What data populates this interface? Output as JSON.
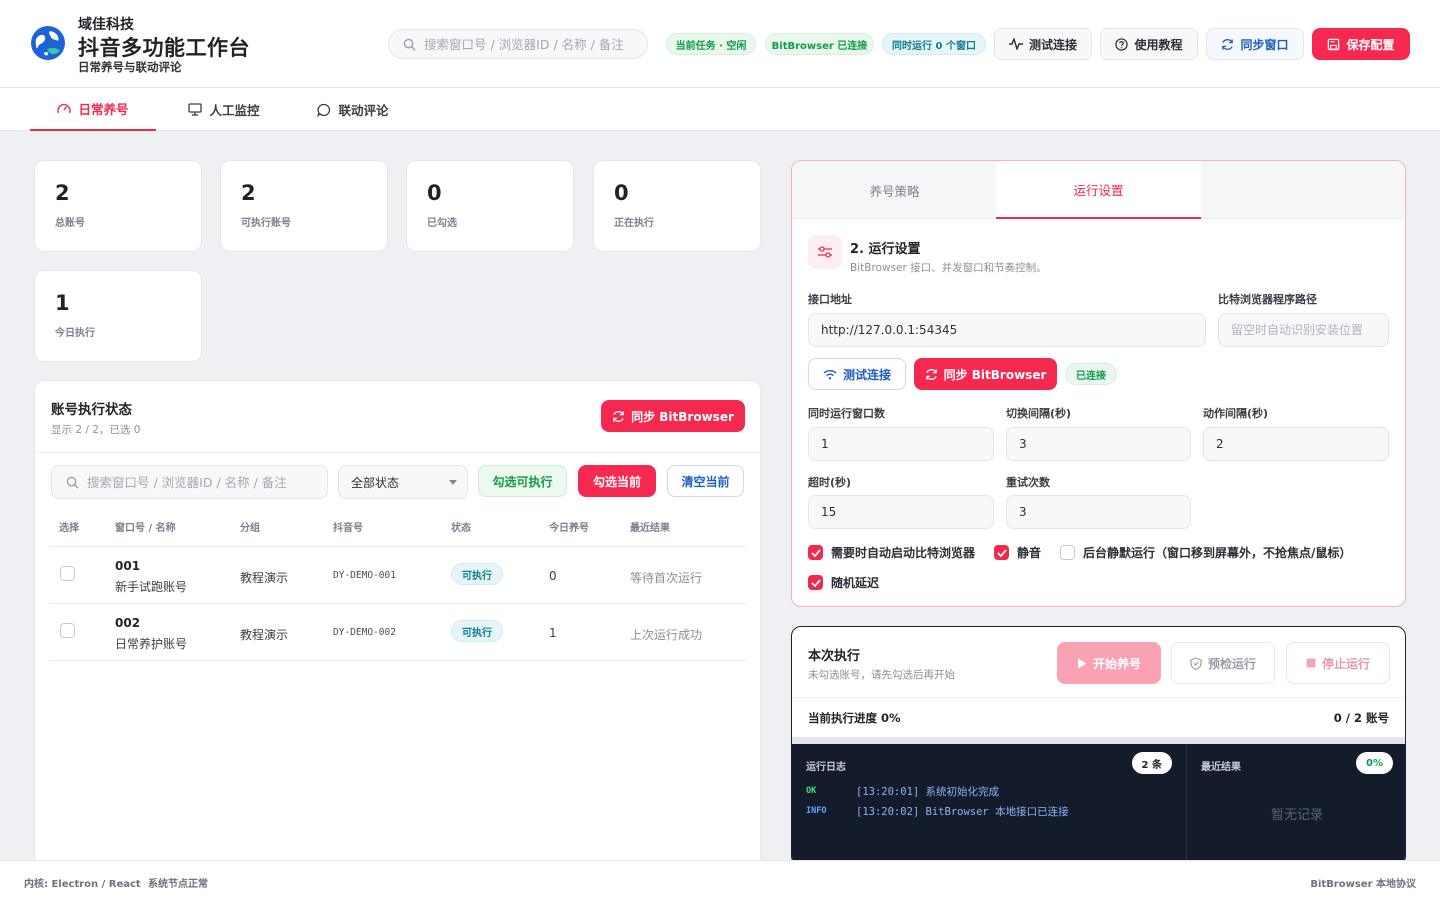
{
  "app": {
    "company": "域佳科技",
    "title": "抖音多功能工作台",
    "subtitle": "日常养号与联动评论"
  },
  "header": {
    "search_placeholder": "搜索窗口号 / 浏览器ID / 名称 / 备注",
    "pills": [
      "当前任务 · 空闲",
      "BitBrowser 已连接",
      "同时运行 0 个窗口"
    ],
    "buttons": {
      "test": "测试连接",
      "tutorial": "使用教程",
      "sync": "同步窗口",
      "save": "保存配置"
    }
  },
  "tabs": [
    "日常养号",
    "人工监控",
    "联动评论"
  ],
  "active_tab": "日常养号",
  "stats": [
    {
      "value": "2",
      "label": "总账号"
    },
    {
      "value": "2",
      "label": "可执行账号"
    },
    {
      "value": "0",
      "label": "已勾选"
    },
    {
      "value": "0",
      "label": "正在执行"
    },
    {
      "value": "1",
      "label": "今日执行"
    }
  ],
  "accounts": {
    "title": "账号执行状态",
    "subtitle": "显示 2 / 2，已选 0",
    "sync_button": "同步 BitBrowser",
    "search_placeholder": "搜索窗口号 / 浏览器ID / 名称 / 备注",
    "filter_value": "全部状态",
    "select_executable": "勾选可执行",
    "select_current": "勾选当前",
    "clear_current": "清空当前",
    "columns": [
      "选择",
      "窗口号 / 名称",
      "分组",
      "抖音号",
      "状态",
      "今日养号",
      "最近结果"
    ],
    "rows": [
      {
        "no": "001",
        "name": "新手试跑账号",
        "group": "教程演示",
        "douyin": "DY-DEMO-001",
        "status": "可执行",
        "today": "0",
        "result": "等待首次运行"
      },
      {
        "no": "002",
        "name": "日常养护账号",
        "group": "教程演示",
        "douyin": "DY-DEMO-002",
        "status": "可执行",
        "today": "1",
        "result": "上次运行成功"
      }
    ]
  },
  "settings": {
    "tabs": [
      "养号策略",
      "运行设置"
    ],
    "active_tab": "运行设置",
    "title": "2. 运行设置",
    "desc": "BitBrowser 接口、并发窗口和节奏控制。",
    "api_label": "接口地址",
    "api_value": "http://127.0.0.1:54345",
    "path_label": "比特浏览器程序路径",
    "path_placeholder": "留空时自动识别安装位置",
    "test_button": "测试连接",
    "sync_button": "同步 BitBrowser",
    "connected": "已连接",
    "concurrent_label": "同时运行窗口数",
    "concurrent_value": "1",
    "switch_label": "切换间隔(秒)",
    "switch_value": "3",
    "action_label": "动作间隔(秒)",
    "action_value": "2",
    "timeout_label": "超时(秒)",
    "timeout_value": "15",
    "retry_label": "重试次数",
    "retry_value": "3",
    "checks": [
      {
        "label": "需要时自动启动比特浏览器",
        "checked": true
      },
      {
        "label": "静音",
        "checked": true
      },
      {
        "label": "后台静默运行（窗口移到屏幕外，不抢焦点/鼠标）",
        "checked": false
      },
      {
        "label": "随机延迟",
        "checked": true
      }
    ]
  },
  "execution": {
    "title": "本次执行",
    "subtitle": "未勾选账号，请先勾选后再开始",
    "start": "开始养号",
    "precheck": "预检运行",
    "stop": "停止运行",
    "progress_label": "当前执行进度 0%",
    "progress_count": "0 / 2 账号",
    "progress": 0,
    "log_title": "运行日志",
    "log_count": "2 条",
    "logs": [
      {
        "level": "OK",
        "text": "[13:20:01] 系统初始化完成",
        "color": "#4ade80"
      },
      {
        "level": "INFO",
        "text": "[13:20:02] BitBrowser 本地接口已连接",
        "color": "#60a5fa"
      }
    ],
    "result_title": "最近结果",
    "result_pct": "0%",
    "result_empty": "暂无记录"
  },
  "footer": {
    "left1": "内核: Electron / React",
    "left2": "系统节点正常",
    "right": "BitBrowser 本地协议"
  },
  "colors": {
    "accent": "#f1294f",
    "success": "#139c48",
    "info": "#0f7c8f",
    "link": "#1f5fbf"
  }
}
